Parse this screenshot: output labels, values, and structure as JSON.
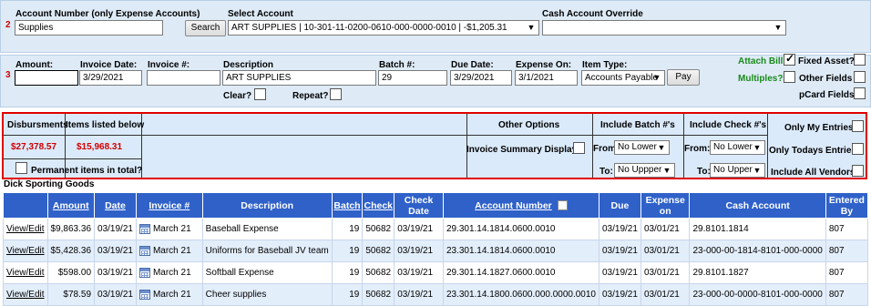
{
  "row1": {
    "step": "2",
    "account_number_label": "Account Number (only Expense Accounts)",
    "account_number_value": "Supplies",
    "search_label": "Search",
    "select_account_label": "Select Account",
    "select_account_value": "ART SUPPLIES | 10-301-11-0200-0610-000-0000-0010 | -$1,205.31",
    "cash_override_label": "Cash Account Override",
    "cash_override_value": ""
  },
  "row2": {
    "step": "3",
    "amount_label": "Amount:",
    "amount_value": "",
    "invoice_date_label": "Invoice Date:",
    "invoice_date_value": "3/29/2021",
    "invoice_num_label": "Invoice #:",
    "invoice_num_value": "",
    "description_label": "Description",
    "description_value": "ART SUPPLIES",
    "batch_label": "Batch #:",
    "batch_value": "29",
    "due_date_label": "Due Date:",
    "due_date_value": "3/29/2021",
    "expense_on_label": "Expense On:",
    "expense_on_value": "3/1/2021",
    "item_type_label": "Item Type:",
    "item_type_value": "Accounts Payable",
    "pay_label": "Pay",
    "clear_label": "Clear?",
    "repeat_label": "Repeat?",
    "attach_bill_label": "Attach Bill",
    "multiples_label": "Multiples?",
    "fixed_asset_label": "Fixed Asset?",
    "other_fields_label": "Other Fields",
    "pcard_fields_label": "pCard Fields"
  },
  "options": {
    "disbursments_label": "Disbursments",
    "items_listed_label": "Items listed below",
    "disbursments_value": "$27,378.57",
    "items_listed_value": "$15,968.31",
    "permanent_label": "Permanent items in total?",
    "other_options_label": "Other Options",
    "invoice_summary_label": "Invoice Summary Display",
    "include_batch_label": "Include Batch #'s",
    "include_check_label": "Include Check #'s",
    "from_label": "From:",
    "to_label": "To:",
    "batch_from_value": "No Lower",
    "batch_to_value": "No Uppper",
    "check_from_value": "No Lower",
    "check_to_value": "No Upper",
    "only_my_label": "Only My Entries",
    "only_todays_label": "Only Todays Entries",
    "include_vendors_label": "Include All Vendors"
  },
  "vendor_title": "Dick Sporting Goods",
  "table": {
    "headers": {
      "amount": "Amount",
      "date": "Date",
      "invoice": "Invoice #",
      "description": "Description",
      "batch": "Batch",
      "check": "Check",
      "check_date": "Check Date",
      "account_number": "Account Number",
      "due": "Due",
      "expense_on": "Expense on",
      "cash_account": "Cash Account",
      "entered_by": "Entered By"
    },
    "rows": [
      {
        "action": "View/Edit",
        "amount": "$9,863.36",
        "date": "03/19/21",
        "invoice": "March 21",
        "description": "Baseball Expense",
        "batch": "19",
        "check": "50682",
        "check_date": "03/19/21",
        "account": "29.301.14.1814.0600.0010",
        "due": "03/19/21",
        "expense_on": "03/01/21",
        "cash_account": "29.8101.1814",
        "entered_by": "807"
      },
      {
        "action": "View/Edit",
        "amount": "$5,428.36",
        "date": "03/19/21",
        "invoice": "March 21",
        "description": "Uniforms for Baseball JV team",
        "batch": "19",
        "check": "50682",
        "check_date": "03/19/21",
        "account": "23.301.14.1814.0600.0010",
        "due": "03/19/21",
        "expense_on": "03/01/21",
        "cash_account": "23-000-00-1814-8101-000-0000",
        "entered_by": "807"
      },
      {
        "action": "View/Edit",
        "amount": "$598.00",
        "date": "03/19/21",
        "invoice": "March 21",
        "description": "Softball Expense",
        "batch": "19",
        "check": "50682",
        "check_date": "03/19/21",
        "account": "29.301.14.1827.0600.0010",
        "due": "03/19/21",
        "expense_on": "03/01/21",
        "cash_account": "29.8101.1827",
        "entered_by": "807"
      },
      {
        "action": "View/Edit",
        "amount": "$78.59",
        "date": "03/19/21",
        "invoice": "March 21",
        "description": "Cheer supplies",
        "batch": "19",
        "check": "50682",
        "check_date": "03/19/21",
        "account": "23.301.14.1800.0600.000.0000.0010",
        "due": "03/19/21",
        "expense_on": "03/01/21",
        "cash_account": "23-000-00-0000-8101-000-0000",
        "entered_by": "807"
      }
    ]
  },
  "colors": {
    "header_blue": "#2f61c9",
    "panel_blue": "#deebf7",
    "alert_red": "#d00000",
    "link_green": "#1a8a1a"
  }
}
